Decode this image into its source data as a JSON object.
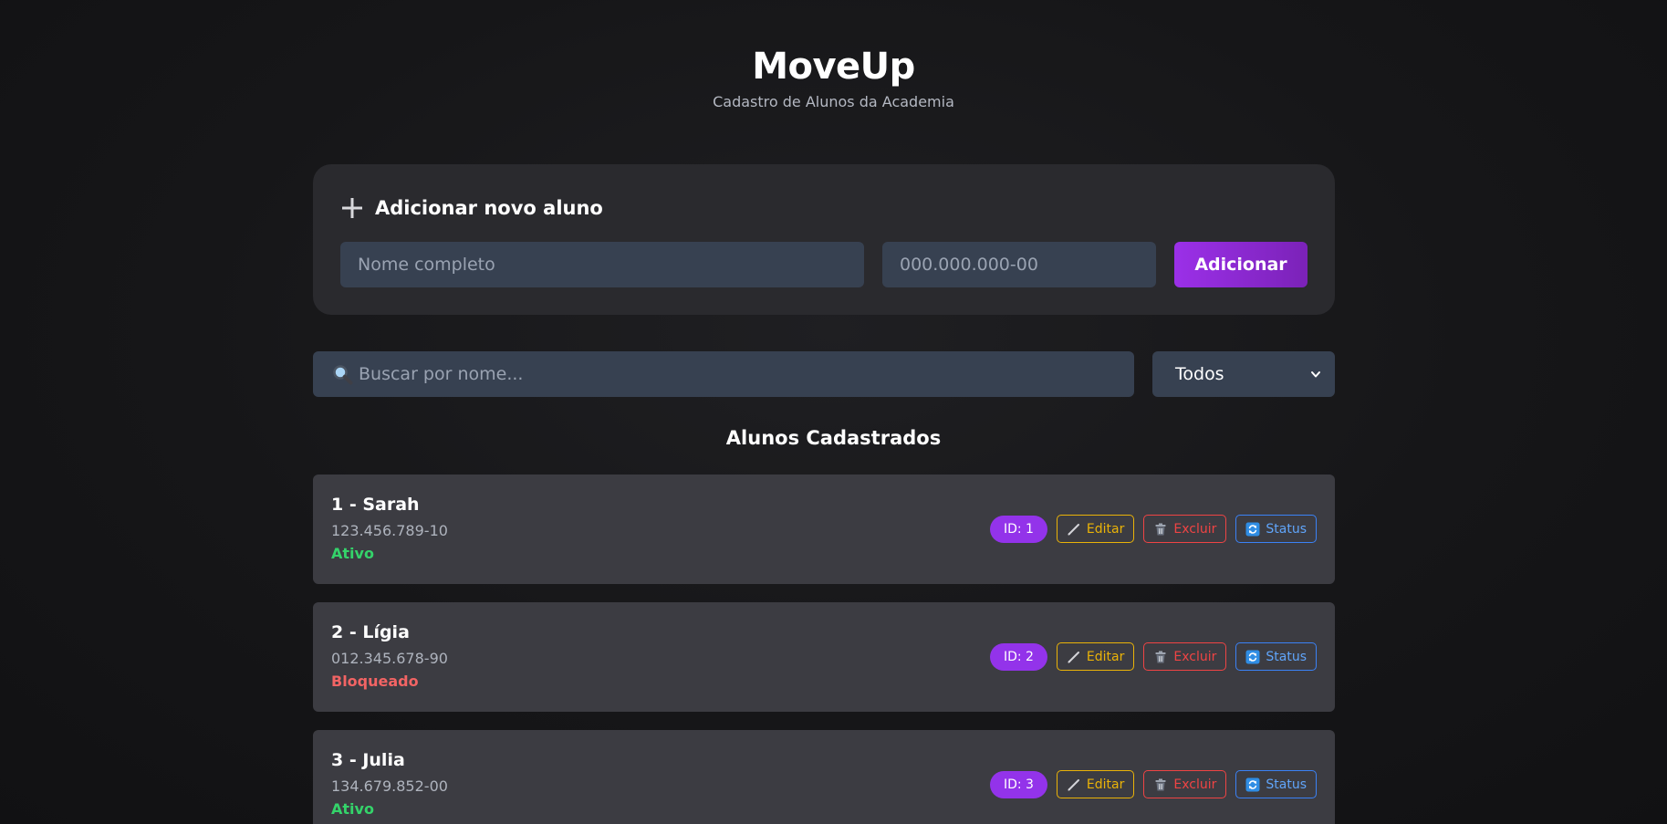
{
  "header": {
    "title": "MoveUp",
    "subtitle": "Cadastro de Alunos da Academia"
  },
  "add_form": {
    "heading": "Adicionar novo aluno",
    "name_placeholder": "Nome completo",
    "cpf_placeholder": "000.000.000-00",
    "submit_label": "Adicionar"
  },
  "search": {
    "placeholder": "Buscar por nome..."
  },
  "filter": {
    "selected": "Todos"
  },
  "list": {
    "title": "Alunos Cadastrados",
    "students": [
      {
        "name": "1 - Sarah",
        "cpf": "123.456.789-10",
        "status": "Ativo",
        "id_label": "ID: 1"
      },
      {
        "name": "2 - Lígia",
        "cpf": "012.345.678-90",
        "status": "Bloqueado",
        "id_label": "ID: 2"
      },
      {
        "name": "3 - Julia",
        "cpf": "134.679.852-00",
        "status": "Ativo",
        "id_label": "ID: 3"
      }
    ],
    "actions": {
      "edit_label": "Editar",
      "delete_label": "Excluir",
      "status_label": "Status"
    }
  },
  "colors": {
    "accent": "#9333ea",
    "status_active": "#34d36a",
    "status_blocked": "#f26464",
    "edit": "#eab308",
    "delete": "#ef4444",
    "status_button": "#3b82f6"
  },
  "icons": {
    "add": "plus-icon",
    "search": "search-icon",
    "filter": "chevron-down-icon",
    "edit": "pencil-icon",
    "delete": "trash-icon",
    "status": "refresh-icon"
  }
}
